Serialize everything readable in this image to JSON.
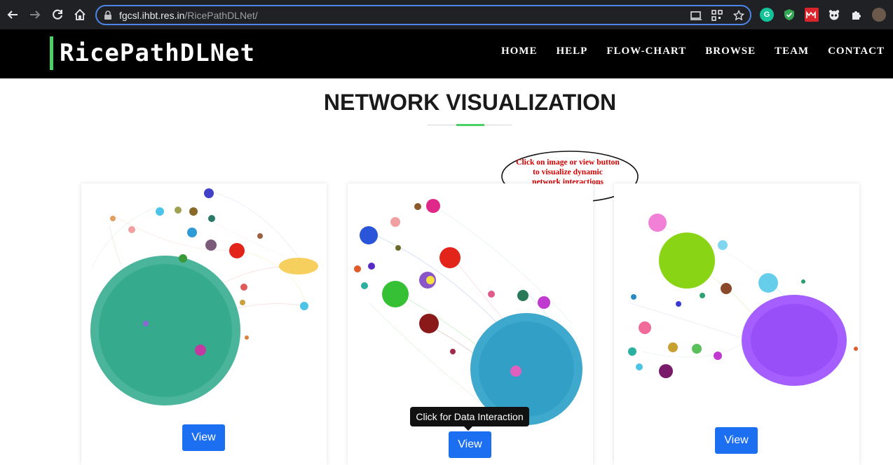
{
  "browser": {
    "url_host": "fgcsl.ihbt.res.in",
    "url_path": "/RicePathDLNet/",
    "icons": [
      "back-icon",
      "forward-icon",
      "reload-icon",
      "home-icon",
      "lock-icon",
      "cast-icon",
      "qr-icon",
      "star-icon",
      "puzzle-icon"
    ],
    "extensions": [
      "grammarly",
      "shield",
      "red-extension",
      "panda",
      "profile-avatar"
    ]
  },
  "site": {
    "brand": "RicePathDLNet",
    "menu": [
      "HOME",
      "HELP",
      "FLOW-CHART",
      "BROWSE",
      "TEAM",
      "CONTACT"
    ]
  },
  "main": {
    "title": "NETWORK VISUALIZATION",
    "callout": [
      "Click on image or view button",
      "to visualize dynamic",
      "network interactions"
    ],
    "tooltip": "Click for Data Interaction",
    "cards": [
      {
        "button": "View",
        "main_color": "#2aa88a"
      },
      {
        "button": "View",
        "main_color": "#2aa0c8"
      },
      {
        "button": "View",
        "main_color": "#9b4dff"
      }
    ]
  },
  "colors": {
    "accent": "#4bd166",
    "button": "#1d6ff2",
    "callout_text": "#d40000"
  }
}
